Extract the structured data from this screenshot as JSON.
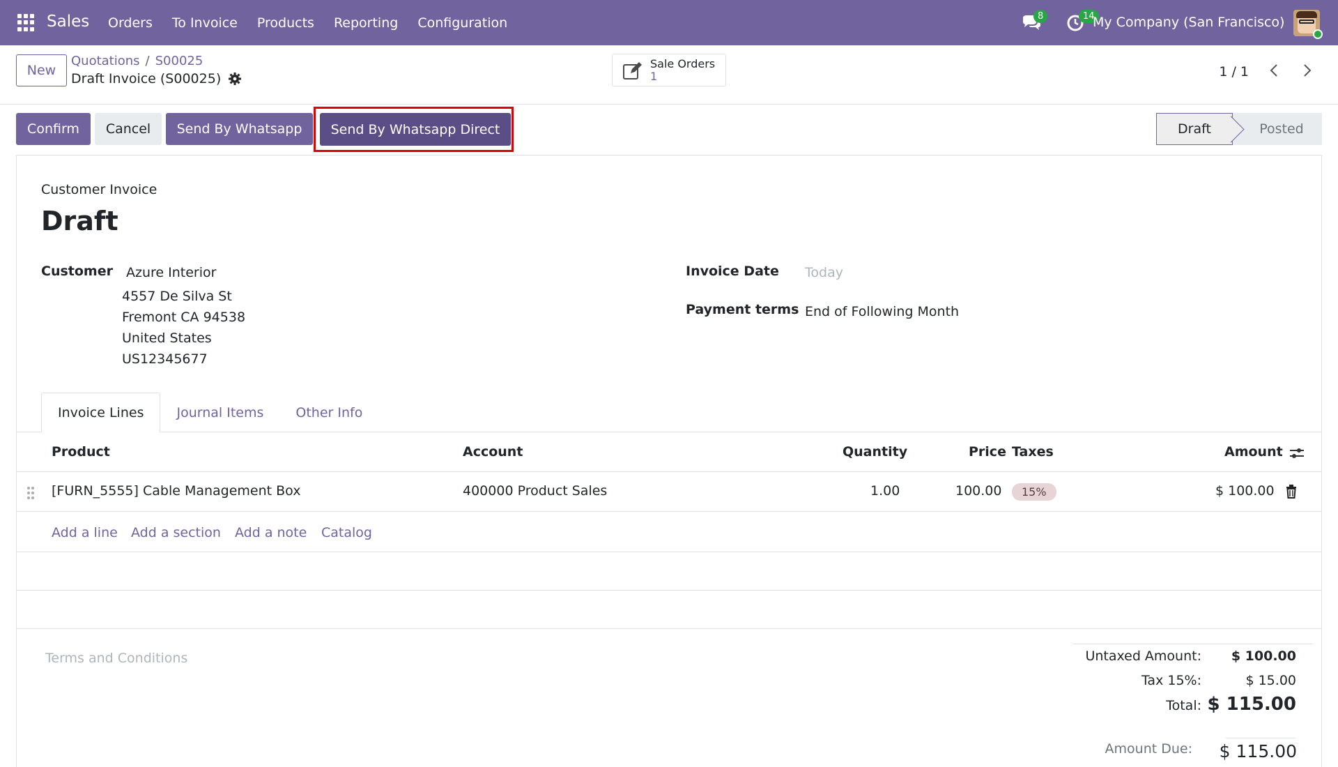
{
  "navbar": {
    "brand": "Sales",
    "menu": [
      "Orders",
      "To Invoice",
      "Products",
      "Reporting",
      "Configuration"
    ],
    "chat_count": "8",
    "activity_count": "14",
    "company": "My Company (San Francisco)",
    "color": "#71639e"
  },
  "control_panel": {
    "new_label": "New",
    "breadcrumb": [
      "Quotations",
      "S00025"
    ],
    "breadcrumb_sep": "/",
    "record_title": "Draft Invoice (S00025)",
    "smart_button": {
      "label": "Sale Orders",
      "value": "1"
    },
    "pager": "1 / 1"
  },
  "actions": {
    "confirm": "Confirm",
    "cancel": "Cancel",
    "send_whatsapp": "Send By Whatsapp",
    "send_whatsapp_direct": "Send By Whatsapp Direct",
    "highlight_color": "#e00000"
  },
  "status": {
    "current": "Draft",
    "next": "Posted"
  },
  "form": {
    "doc_type": "Customer Invoice",
    "title": "Draft",
    "customer_label": "Customer",
    "customer_name": "Azure Interior",
    "address": [
      "4557 De Silva St",
      "Fremont CA 94538",
      "United States",
      "US12345677"
    ],
    "invoice_date_label": "Invoice Date",
    "invoice_date_placeholder": "Today",
    "payment_terms_label": "Payment terms",
    "payment_terms_value": "End of Following Month"
  },
  "tabs": [
    "Invoice Lines",
    "Journal Items",
    "Other Info"
  ],
  "table": {
    "headers": {
      "product": "Product",
      "account": "Account",
      "quantity": "Quantity",
      "price": "Price",
      "taxes": "Taxes",
      "amount": "Amount"
    },
    "rows": [
      {
        "product": "[FURN_5555] Cable Management Box",
        "account": "400000 Product Sales",
        "quantity": "1.00",
        "price": "100.00",
        "tax": "15%",
        "amount": "$ 100.00"
      }
    ],
    "add_links": [
      "Add a line",
      "Add a section",
      "Add a note",
      "Catalog"
    ]
  },
  "footer": {
    "terms_placeholder": "Terms and Conditions",
    "untaxed_label": "Untaxed Amount:",
    "untaxed_value": "$ 100.00",
    "tax_label": "Tax 15%:",
    "tax_value": "$ 15.00",
    "total_label": "Total:",
    "total_value": "$ 115.00",
    "due_label": "Amount Due:",
    "due_value": "$ 115.00"
  },
  "icons": [
    "apps-icon",
    "chat-icon",
    "activity-clock-icon",
    "gear-icon",
    "edit-icon",
    "chevron-left-icon",
    "chevron-right-icon",
    "drag-handle-icon",
    "trash-icon",
    "column-settings-icon"
  ]
}
